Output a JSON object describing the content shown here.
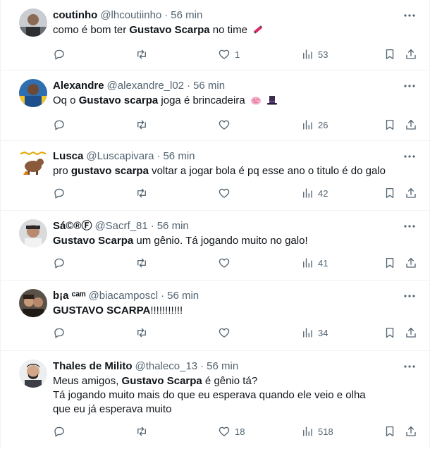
{
  "tweets": [
    {
      "name": "coutinho",
      "handle": "@lhcoutiinho",
      "time": "56 min",
      "text_before": "como é bom ter ",
      "highlight": "Gustavo Scarpa",
      "text_after": " no time",
      "emoji": "skateboard",
      "replies": "",
      "retweets": "",
      "likes": "1",
      "views": "53"
    },
    {
      "name": "Alexandre",
      "handle": "@alexandre_l02",
      "time": "56 min",
      "text_before": "Oq o ",
      "highlight": "Gustavo scarpa",
      "text_after": " joga é brincadeira",
      "emoji": "brain and top hat",
      "replies": "",
      "retweets": "",
      "likes": "",
      "views": "26"
    },
    {
      "name": "Lusca",
      "handle": "@Luscapivara",
      "time": "56 min",
      "text_before": "pro ",
      "highlight": "gustavo scarpa",
      "text_after": " voltar a jogar bola é pq esse ano o titulo é do galo",
      "replies": "",
      "retweets": "",
      "likes": "",
      "views": "42"
    },
    {
      "name": "Sá©®Ⓕ",
      "handle": "@Sacrf_81",
      "time": "56 min",
      "text_before": "",
      "highlight": "Gustavo Scarpa",
      "text_after": " um gênio. Tá jogando muito no galo!",
      "replies": "",
      "retweets": "",
      "likes": "",
      "views": "41"
    },
    {
      "name": "b¡a ᶜᵃᵐ",
      "handle": "@biacamposcl",
      "time": "56 min",
      "text_before": "",
      "highlight": "GUSTAVO SCARPA",
      "text_after": "!!!!!!!!!!!",
      "replies": "",
      "retweets": "",
      "likes": "",
      "views": "34"
    },
    {
      "name": "Thales de Milito",
      "handle": "@thaleco_13",
      "time": "56 min",
      "text_before": "Meus amigos, ",
      "highlight": "Gustavo Scarpa",
      "text_after": " é gênio tá?",
      "text_extra": "Tá jogando muito mais do que eu esperava quando ele veio e olha que eu já esperava muito",
      "replies": "",
      "retweets": "",
      "likes": "18",
      "views": "518"
    }
  ],
  "icons": {
    "reply": "reply-icon",
    "retweet": "retweet-icon",
    "like": "heart-icon",
    "views": "views-icon",
    "bookmark": "bookmark-icon",
    "share": "share-icon",
    "more": "more-icon"
  },
  "colors": {
    "text": "#0f1419",
    "secondary": "#536471",
    "border": "#eff3f4"
  }
}
